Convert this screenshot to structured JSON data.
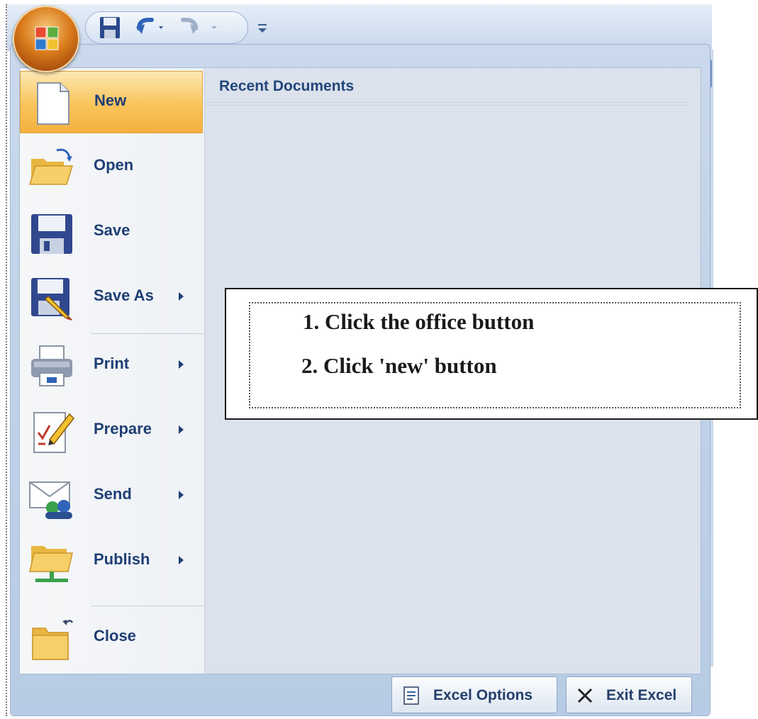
{
  "quick_access_toolbar": {
    "icons": [
      "save-icon",
      "undo-icon",
      "redo-icon",
      "customize-toolbar-icon"
    ]
  },
  "office_menu": {
    "recent_documents_title": "Recent Documents",
    "items": [
      {
        "label": "New",
        "icon": "new-document-icon",
        "has_submenu": false,
        "active": true
      },
      {
        "label": "Open",
        "icon": "open-folder-icon",
        "has_submenu": false
      },
      {
        "label": "Save",
        "icon": "save-disk-icon",
        "has_submenu": false
      },
      {
        "label": "Save As",
        "icon": "save-as-icon",
        "has_submenu": true
      },
      {
        "label": "Print",
        "icon": "printer-icon",
        "has_submenu": true
      },
      {
        "label": "Prepare",
        "icon": "prepare-icon",
        "has_submenu": true
      },
      {
        "label": "Send",
        "icon": "send-icon",
        "has_submenu": true
      },
      {
        "label": "Publish",
        "icon": "publish-icon",
        "has_submenu": true
      },
      {
        "label": "Close",
        "icon": "close-folder-icon",
        "has_submenu": false
      }
    ],
    "buttons": {
      "options_label": "Excel Options",
      "exit_label": "Exit Excel"
    }
  },
  "annotation": {
    "steps": [
      "1.  Click the office button",
      "2.  Click 'new' button"
    ]
  },
  "colors": {
    "active_highlight": "#f9c45a",
    "label_text": "#1f3f74",
    "office_button": "#d97a1b"
  }
}
